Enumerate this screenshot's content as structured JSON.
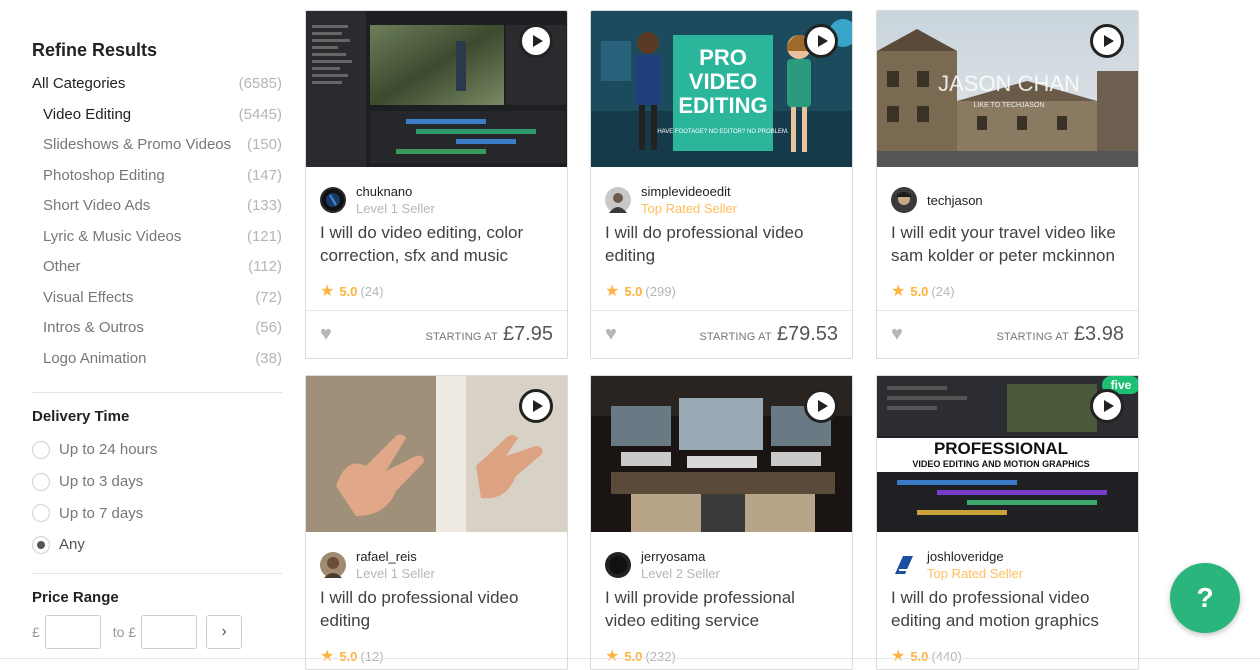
{
  "sidebar": {
    "title": "Refine Results",
    "categories": [
      {
        "label": "All Categories",
        "count": "(6585)"
      },
      {
        "label": "Video Editing",
        "count": "(5445)"
      },
      {
        "label": "Slideshows & Promo Videos",
        "count": "(150)"
      },
      {
        "label": "Photoshop Editing",
        "count": "(147)"
      },
      {
        "label": "Short Video Ads",
        "count": "(133)"
      },
      {
        "label": "Lyric & Music Videos",
        "count": "(121)"
      },
      {
        "label": "Other",
        "count": "(112)"
      },
      {
        "label": "Visual Effects",
        "count": "(72)"
      },
      {
        "label": "Intros & Outros",
        "count": "(56)"
      },
      {
        "label": "Logo Animation",
        "count": "(38)"
      }
    ],
    "delivery": {
      "title": "Delivery Time",
      "options": [
        "Up to 24 hours",
        "Up to 3 days",
        "Up to 7 days",
        "Any"
      ],
      "selected": "Any"
    },
    "price": {
      "title": "Price Range",
      "currency": "£",
      "to_label": "to",
      "go_icon": "chevron-right-icon"
    }
  },
  "cards": [
    {
      "seller": "chuknano",
      "level": "Level 1 Seller",
      "title": "I will do video editing, color correction, sfx and music",
      "score": "5.0",
      "reviews": "(24)",
      "starting": "STARTING AT",
      "price": "£7.95"
    },
    {
      "seller": "simplevideoedit",
      "level": "Top Rated Seller",
      "title": "I will do professional video editing",
      "score": "5.0",
      "reviews": "(299)",
      "starting": "STARTING AT",
      "price": "£79.53",
      "thumb_text": {
        "line1": "PRO",
        "line2": "VIDEO",
        "line3": "EDITING",
        "tagline": "HAVE FOOTAGE? NO EDITOR? NO PROBLEM."
      }
    },
    {
      "seller": "techjason",
      "level": "",
      "title": "I will edit your travel video like sam kolder or peter mckinnon",
      "score": "5.0",
      "reviews": "(24)",
      "starting": "STARTING AT",
      "price": "£3.98",
      "thumb_text": {
        "line1": "JASON CHAN",
        "line2": "LIKE TO TECHJASON"
      }
    },
    {
      "seller": "rafael_reis",
      "level": "Level 1 Seller",
      "title": "I will do professional video editing",
      "score": "5.0",
      "reviews": "(12)"
    },
    {
      "seller": "jerryosama",
      "level": "Level 2 Seller",
      "title": "I will provide professional video editing service",
      "score": "5.0",
      "reviews": "(232)"
    },
    {
      "seller": "joshloveridge",
      "level": "Top Rated Seller",
      "title": "I will do professional video editing and motion graphics",
      "score": "5.0",
      "reviews": "(440)",
      "thumb_text": {
        "line1": "PROFESSIONAL",
        "line2": "VIDEO EDITING AND MOTION GRAPHICS",
        "badge": "five"
      }
    }
  ],
  "help_label": "?",
  "colors": {
    "accent_green": "#2ab57d",
    "star": "#ffb33e",
    "top_rated": "#ffbe5b"
  }
}
